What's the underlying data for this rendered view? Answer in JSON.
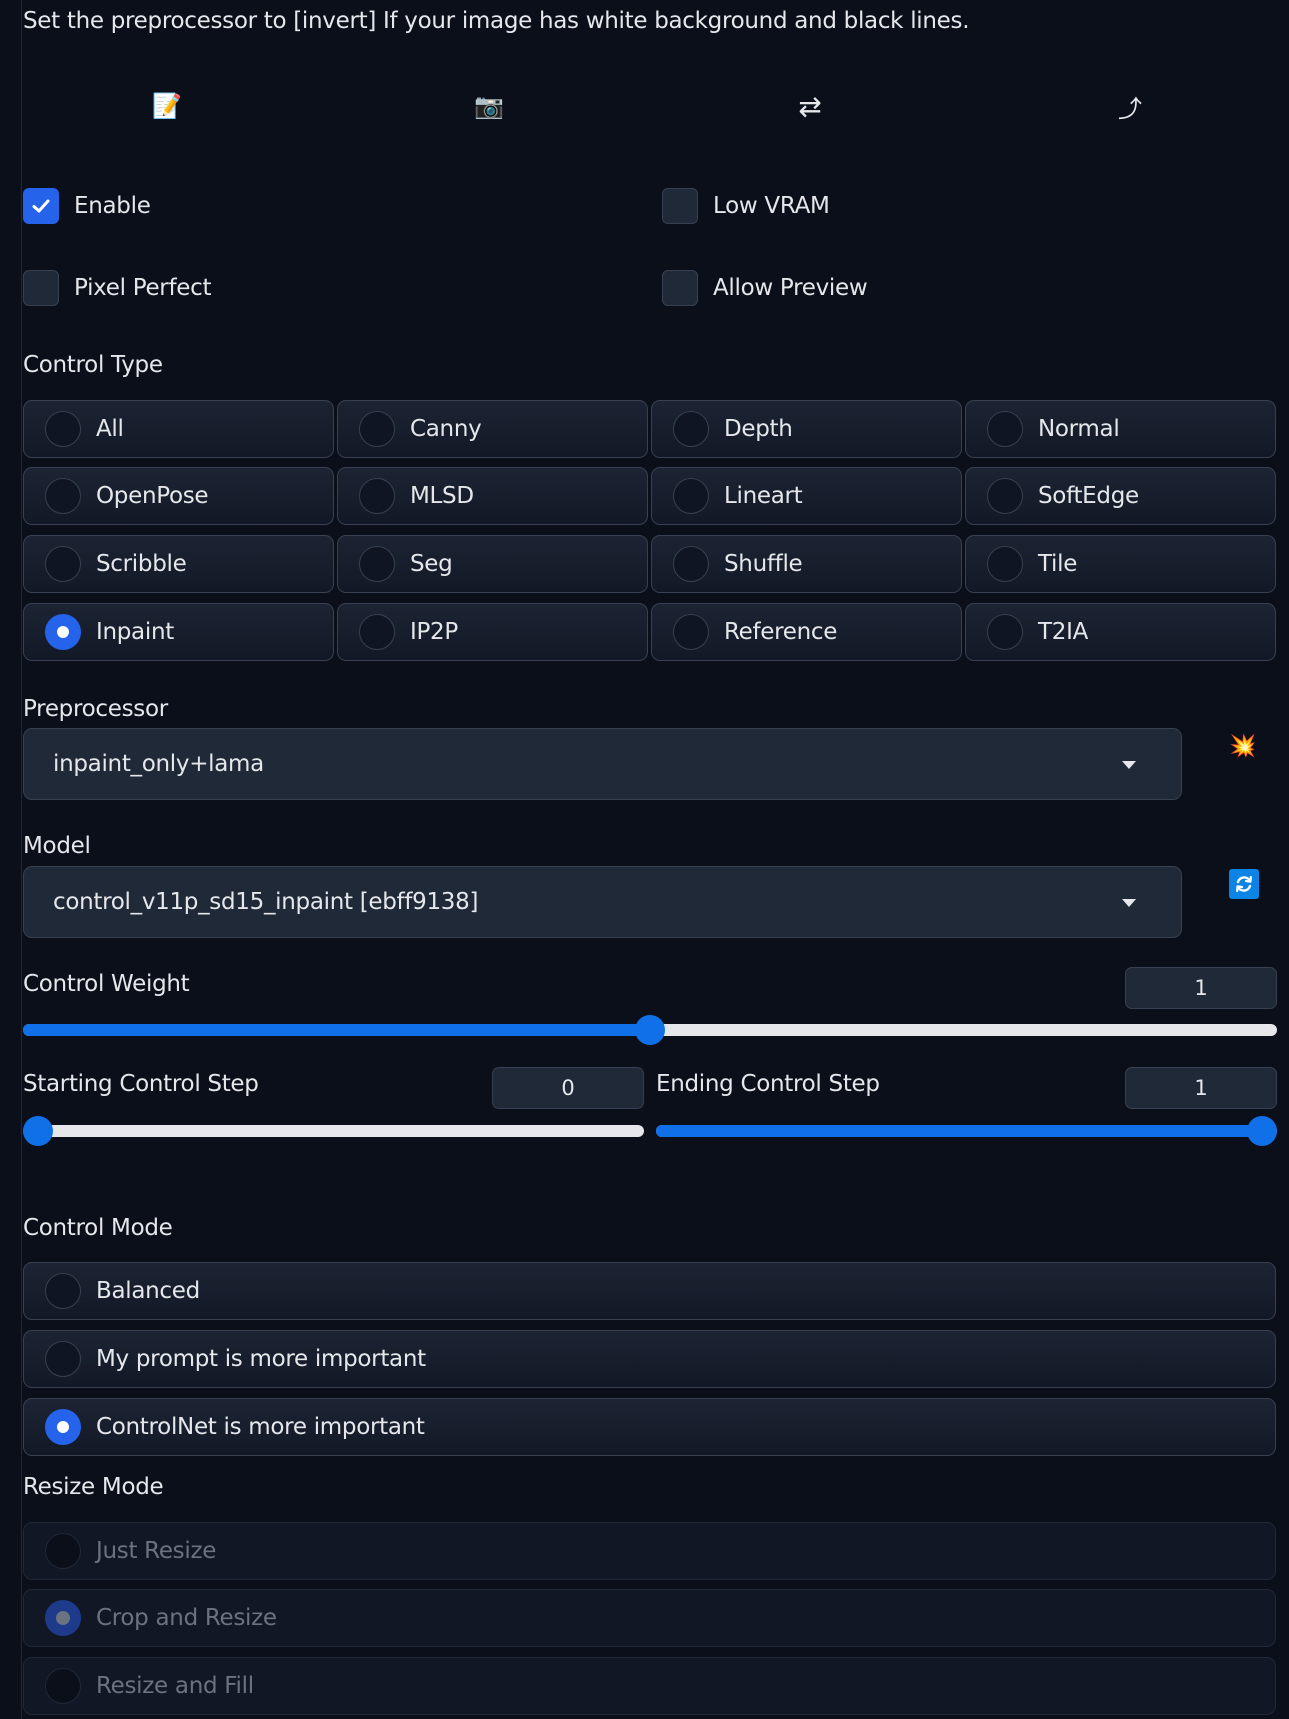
{
  "hint": "Set the preprocessor to [invert] If your image has white background and black lines.",
  "toolbar": [
    {
      "icon": "memo-icon",
      "glyph": "📝"
    },
    {
      "icon": "camera-icon",
      "glyph": "📷"
    },
    {
      "icon": "swap-arrows-icon",
      "glyph": "⇄"
    },
    {
      "icon": "upload-arrow-icon",
      "glyph": "⤴"
    }
  ],
  "checkboxes": {
    "enable": {
      "label": "Enable",
      "checked": true
    },
    "low_vram": {
      "label": "Low VRAM",
      "checked": false
    },
    "pixel_perfect": {
      "label": "Pixel Perfect",
      "checked": false
    },
    "allow_preview": {
      "label": "Allow Preview",
      "checked": false
    }
  },
  "control_type": {
    "label": "Control Type",
    "options": [
      "All",
      "Canny",
      "Depth",
      "Normal",
      "OpenPose",
      "MLSD",
      "Lineart",
      "SoftEdge",
      "Scribble",
      "Seg",
      "Shuffle",
      "Tile",
      "Inpaint",
      "IP2P",
      "Reference",
      "T2IA"
    ],
    "selected": "Inpaint"
  },
  "preprocessor": {
    "label": "Preprocessor",
    "value": "inpaint_only+lama",
    "action_icon": "explosion-icon",
    "action_glyph": "💥"
  },
  "model": {
    "label": "Model",
    "value": "control_v11p_sd15_inpaint [ebff9138]",
    "action_icon": "refresh-icon",
    "action_glyph": "🔄"
  },
  "control_weight": {
    "label": "Control Weight",
    "value": "1",
    "fraction": 0.5
  },
  "starting_step": {
    "label": "Starting Control Step",
    "value": "0",
    "fraction": 0
  },
  "ending_step": {
    "label": "Ending Control Step",
    "value": "1",
    "fraction": 1
  },
  "control_mode": {
    "label": "Control Mode",
    "options": [
      "Balanced",
      "My prompt is more important",
      "ControlNet is more important"
    ],
    "selected": "ControlNet is more important"
  },
  "resize_mode": {
    "label": "Resize Mode",
    "options": [
      "Just Resize",
      "Crop and Resize",
      "Resize and Fill"
    ],
    "selected": "Crop and Resize",
    "disabled": true
  },
  "colors": {
    "accent": "#2563eb",
    "slider": "#1070e8",
    "background": "#0b0f19",
    "panel": "#1f2937"
  }
}
